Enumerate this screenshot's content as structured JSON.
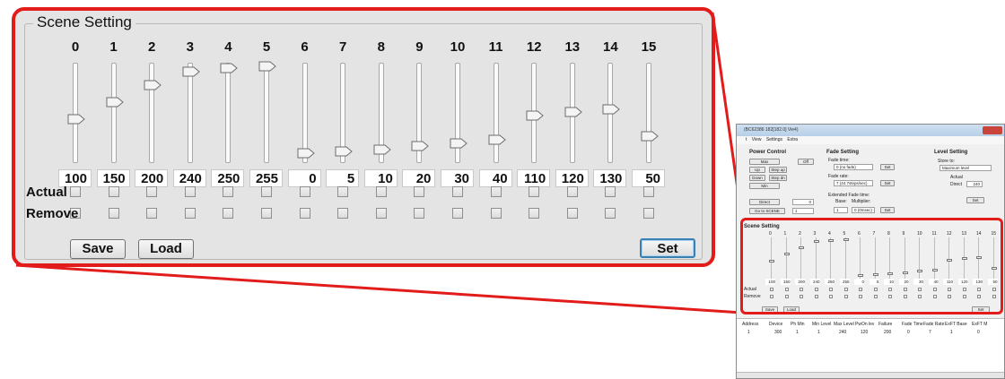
{
  "scene_panel": {
    "title": "Scene Setting",
    "channels": [
      "0",
      "1",
      "2",
      "3",
      "4",
      "5",
      "6",
      "7",
      "8",
      "9",
      "10",
      "11",
      "12",
      "13",
      "14",
      "15"
    ],
    "values": [
      "100",
      "150",
      "200",
      "240",
      "250",
      "255",
      "0",
      "5",
      "10",
      "20",
      "30",
      "40",
      "110",
      "120",
      "130",
      "50"
    ],
    "levels": [
      100,
      150,
      200,
      240,
      250,
      255,
      0,
      5,
      10,
      20,
      30,
      40,
      110,
      120,
      130,
      50
    ],
    "actual_label": "Actual",
    "remove_label": "Remove",
    "save_label": "Save",
    "load_label": "Load",
    "set_label": "Set"
  },
  "mini_window": {
    "title": "(BC62386 182[182.0] Vie4)",
    "menu": [
      "t",
      "View",
      "Settings",
      "Extra"
    ],
    "power_control": {
      "title": "Power Control",
      "buttons": [
        "Max",
        "Off",
        "Up",
        "Step up",
        "Down",
        "Step dn",
        "Min",
        "Direct",
        "Go to SCENE"
      ],
      "direct_value": "0",
      "scene_value": "1"
    },
    "fade_setting": {
      "title": "Fade Setting",
      "fade_time_label": "Fade time:",
      "fade_time_value": "0 (no fade)",
      "fade_rate_label": "Fade rate:",
      "fade_rate_value": "7 (44.7steps/sec)",
      "ext_label": "Extended Fade time:",
      "base_label": "Base:",
      "multiplier_label": "Multiplier:",
      "base_value": "1",
      "multiplier_value": "0 (0msec)",
      "set_label": "Set"
    },
    "level_setting": {
      "title": "Level Setting",
      "store_label": "Store to:",
      "store_value": "Maximum level",
      "actual_label": "Actual",
      "direct_label": "Direct",
      "direct_value": "240",
      "set_label": "Set"
    },
    "scene": {
      "title": "Scene Setting",
      "actual_label": "Actual",
      "remove_label": "Remove",
      "save_label": "Save",
      "load_label": "Load",
      "set_label": "Set"
    },
    "table": {
      "headers": [
        "Address",
        "Device",
        "Ph Min",
        "Min Level",
        "Max Level",
        "PwOn lev",
        "Failure",
        "Fade Time",
        "Fade Rate",
        "ExFT Base",
        "ExFT M"
      ],
      "row": [
        "1",
        "300",
        "1",
        "1",
        "240",
        "120",
        "200",
        "0",
        "7",
        "1",
        "0"
      ]
    }
  },
  "colors": {
    "highlight": "#e21b1b",
    "panel_bg": "#e4e4e4",
    "set_button_border": "#3c7fb1"
  }
}
